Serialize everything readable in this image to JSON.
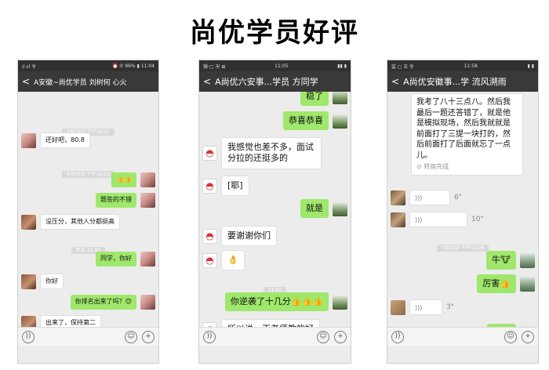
{
  "title": "尚优学员好评",
  "p1": {
    "status_left": "ıl ııl 令",
    "status_right": "⏰ ✆ 96% ▮ 11:04",
    "chat_title": "A安徽~尚优学员 刘树何 心火",
    "ts1": "6月29日 下午16:07",
    "ts2": "6月29日 下午16:13",
    "ts3": "昨天 11:00",
    "m1": "还好吧，80.8",
    "m2": "👍👍",
    "m3": "题答的不错",
    "m4": "没压分，其他人分都挺高",
    "m5": "同学，你好",
    "m6": "你好",
    "m7": "你排名出来了吗？😊",
    "m8": "出来了，保持第二",
    "m9": "👍👍👍👍"
  },
  "p2": {
    "status_left": "微·▢ 卍 ⊞",
    "status_center": "11:05",
    "status_right": "▮▮ ▮",
    "chat_title": "A尚优六安事...学员 方同学",
    "ts1": "11:00",
    "m1": "稳了",
    "m2": "恭喜恭喜",
    "m3": "我感觉也差不多，面试分拉的还挺多的",
    "m4": "[耶]",
    "m5": "就是",
    "m6": "要谢谢你们",
    "m7": "👌",
    "m8": "你逆袭了十几分",
    "m8_emoji": "👍👍👍",
    "m9": "所以说，王老师教的好"
  },
  "p3": {
    "status_left": "监 ▢ ☰ 令",
    "status_center": "11:58",
    "status_right": "▮ ▮",
    "chat_title": "A尚优安徽事...学 流风溯雨",
    "card": "我考了八十三点八。然后我最后一题还答错了，就是他是模拟现场，然后我就就是前面打了三提一块打的，然后前面打了后面就忘了一点儿。",
    "card_status": "转换完成",
    "v1": "6\"",
    "v2": "10\"",
    "ts1": "7月29日 下午13:28",
    "m1": "牛🐮",
    "m2": "厉害👍",
    "v3": "3\"",
    "m3": "😁😁"
  },
  "icons": {
    "voice": "))",
    "emoji": "☺",
    "plus": "+"
  }
}
